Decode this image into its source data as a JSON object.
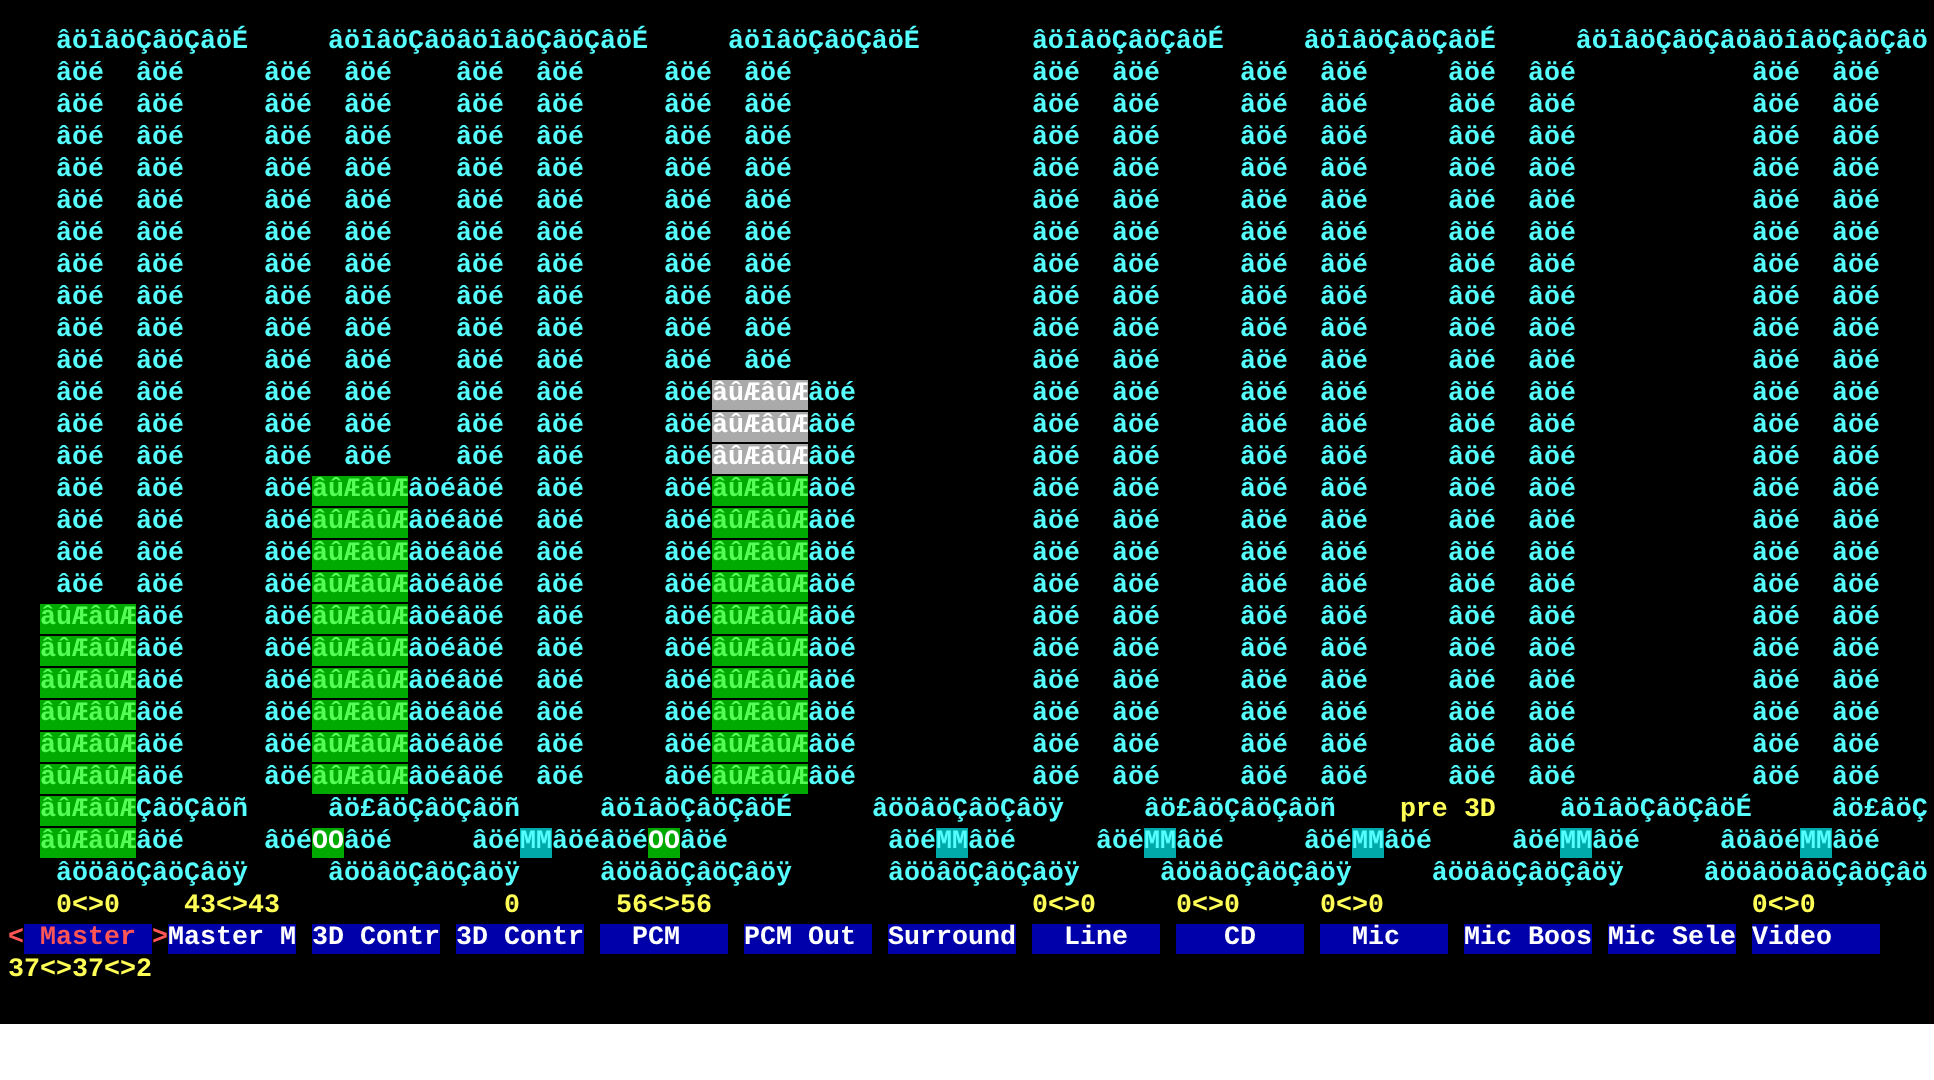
{
  "terminal": {
    "lines": [
      {
        "runs": [
          {
            "kind": "frame",
            "text": "   âöîâöÇâöÇâöÉ     âöîâöÇâöâöîâöÇâöÇâöÉ     âöîâöÇâöÇâöÉ       âöîâöÇâöÇâöÉ     âöîâöÇâöÇâöÉ     âöîâöÇâöÇâöâöîâöÇâöÇâö"
          }
        ]
      },
      {
        "runs": [
          {
            "kind": "frame",
            "text": "   âöé  âöé     âöé  âöé    âöé  âöé     âöé  âöé               âöé  âöé     âöé  âöé     âöé  âöé           âöé  âöé"
          }
        ]
      },
      {
        "runs": [
          {
            "kind": "frame",
            "text": "   âöé  âöé     âöé  âöé    âöé  âöé     âöé  âöé               âöé  âöé     âöé  âöé     âöé  âöé           âöé  âöé"
          }
        ]
      },
      {
        "runs": [
          {
            "kind": "frame",
            "text": "   âöé  âöé     âöé  âöé    âöé  âöé     âöé  âöé               âöé  âöé     âöé  âöé     âöé  âöé           âöé  âöé"
          }
        ]
      },
      {
        "runs": [
          {
            "kind": "frame",
            "text": "   âöé  âöé     âöé  âöé    âöé  âöé     âöé  âöé               âöé  âöé     âöé  âöé     âöé  âöé           âöé  âöé"
          }
        ]
      },
      {
        "runs": [
          {
            "kind": "frame",
            "text": "   âöé  âöé     âöé  âöé    âöé  âöé     âöé  âöé               âöé  âöé     âöé  âöé     âöé  âöé           âöé  âöé"
          }
        ]
      },
      {
        "runs": [
          {
            "kind": "frame",
            "text": "   âöé  âöé     âöé  âöé    âöé  âöé     âöé  âöé               âöé  âöé     âöé  âöé     âöé  âöé           âöé  âöé"
          }
        ]
      },
      {
        "runs": [
          {
            "kind": "frame",
            "text": "   âöé  âöé     âöé  âöé    âöé  âöé     âöé  âöé               âöé  âöé     âöé  âöé     âöé  âöé           âöé  âöé"
          }
        ]
      },
      {
        "runs": [
          {
            "kind": "frame",
            "text": "   âöé  âöé     âöé  âöé    âöé  âöé     âöé  âöé               âöé  âöé     âöé  âöé     âöé  âöé           âöé  âöé"
          }
        ]
      },
      {
        "runs": [
          {
            "kind": "frame",
            "text": "   âöé  âöé     âöé  âöé    âöé  âöé     âöé  âöé               âöé  âöé     âöé  âöé     âöé  âöé           âöé  âöé"
          }
        ]
      },
      {
        "runs": [
          {
            "kind": "frame",
            "text": "   âöé  âöé     âöé  âöé    âöé  âöé     âöé  âöé               âöé  âöé     âöé  âöé     âöé  âöé           âöé  âöé"
          }
        ]
      },
      {
        "runs": [
          {
            "kind": "frame",
            "text": "   âöé  âöé     âöé  âöé    âöé  âöé     âöé"
          },
          {
            "kind": "peak",
            "text": "âûÆâûÆ"
          },
          {
            "kind": "frame",
            "text": "âöé           âöé  âöé     âöé  âöé     âöé  âöé           âöé  âöé"
          }
        ]
      },
      {
        "runs": [
          {
            "kind": "frame",
            "text": "   âöé  âöé     âöé  âöé    âöé  âöé     âöé"
          },
          {
            "kind": "peak",
            "text": "âûÆâûÆ"
          },
          {
            "kind": "frame",
            "text": "âöé           âöé  âöé     âöé  âöé     âöé  âöé           âöé  âöé"
          }
        ]
      },
      {
        "runs": [
          {
            "kind": "frame",
            "text": "   âöé  âöé     âöé  âöé    âöé  âöé     âöé"
          },
          {
            "kind": "peak",
            "text": "âûÆâûÆ"
          },
          {
            "kind": "frame",
            "text": "âöé           âöé  âöé     âöé  âöé     âöé  âöé           âöé  âöé"
          }
        ]
      },
      {
        "runs": [
          {
            "kind": "frame",
            "text": "   âöé  âöé     âöé"
          },
          {
            "kind": "fill",
            "text": "âûÆâûÆ"
          },
          {
            "kind": "frame",
            "text": "âöéâöé  âöé     âöé"
          },
          {
            "kind": "fill",
            "text": "âûÆâûÆ"
          },
          {
            "kind": "frame",
            "text": "âöé           âöé  âöé     âöé  âöé     âöé  âöé           âöé  âöé"
          }
        ]
      },
      {
        "runs": [
          {
            "kind": "frame",
            "text": "   âöé  âöé     âöé"
          },
          {
            "kind": "fill",
            "text": "âûÆâûÆ"
          },
          {
            "kind": "frame",
            "text": "âöéâöé  âöé     âöé"
          },
          {
            "kind": "fill",
            "text": "âûÆâûÆ"
          },
          {
            "kind": "frame",
            "text": "âöé           âöé  âöé     âöé  âöé     âöé  âöé           âöé  âöé"
          }
        ]
      },
      {
        "runs": [
          {
            "kind": "frame",
            "text": "   âöé  âöé     âöé"
          },
          {
            "kind": "fill",
            "text": "âûÆâûÆ"
          },
          {
            "kind": "frame",
            "text": "âöéâöé  âöé     âöé"
          },
          {
            "kind": "fill",
            "text": "âûÆâûÆ"
          },
          {
            "kind": "frame",
            "text": "âöé           âöé  âöé     âöé  âöé     âöé  âöé           âöé  âöé"
          }
        ]
      },
      {
        "runs": [
          {
            "kind": "frame",
            "text": "   âöé  âöé     âöé"
          },
          {
            "kind": "fill",
            "text": "âûÆâûÆ"
          },
          {
            "kind": "frame",
            "text": "âöéâöé  âöé     âöé"
          },
          {
            "kind": "fill",
            "text": "âûÆâûÆ"
          },
          {
            "kind": "frame",
            "text": "âöé           âöé  âöé     âöé  âöé     âöé  âöé           âöé  âöé"
          }
        ]
      },
      {
        "runs": [
          {
            "kind": "fill",
            "text": "  âûÆâûÆ"
          },
          {
            "kind": "frame",
            "text": "âöé     âöé"
          },
          {
            "kind": "fill",
            "text": "âûÆâûÆ"
          },
          {
            "kind": "frame",
            "text": "âöéâöé  âöé     âöé"
          },
          {
            "kind": "fill",
            "text": "âûÆâûÆ"
          },
          {
            "kind": "frame",
            "text": "âöé           âöé  âöé     âöé  âöé     âöé  âöé           âöé  âöé"
          }
        ]
      },
      {
        "runs": [
          {
            "kind": "fill",
            "text": "  âûÆâûÆ"
          },
          {
            "kind": "frame",
            "text": "âöé     âöé"
          },
          {
            "kind": "fill",
            "text": "âûÆâûÆ"
          },
          {
            "kind": "frame",
            "text": "âöéâöé  âöé     âöé"
          },
          {
            "kind": "fill",
            "text": "âûÆâûÆ"
          },
          {
            "kind": "frame",
            "text": "âöé           âöé  âöé     âöé  âöé     âöé  âöé           âöé  âöé"
          }
        ]
      },
      {
        "runs": [
          {
            "kind": "fill",
            "text": "  âûÆâûÆ"
          },
          {
            "kind": "frame",
            "text": "âöé     âöé"
          },
          {
            "kind": "fill",
            "text": "âûÆâûÆ"
          },
          {
            "kind": "frame",
            "text": "âöéâöé  âöé     âöé"
          },
          {
            "kind": "fill",
            "text": "âûÆâûÆ"
          },
          {
            "kind": "frame",
            "text": "âöé           âöé  âöé     âöé  âöé     âöé  âöé           âöé  âöé"
          }
        ]
      },
      {
        "runs": [
          {
            "kind": "fill",
            "text": "  âûÆâûÆ"
          },
          {
            "kind": "frame",
            "text": "âöé     âöé"
          },
          {
            "kind": "fill",
            "text": "âûÆâûÆ"
          },
          {
            "kind": "frame",
            "text": "âöéâöé  âöé     âöé"
          },
          {
            "kind": "fill",
            "text": "âûÆâûÆ"
          },
          {
            "kind": "frame",
            "text": "âöé           âöé  âöé     âöé  âöé     âöé  âöé           âöé  âöé"
          }
        ]
      },
      {
        "runs": [
          {
            "kind": "fill",
            "text": "  âûÆâûÆ"
          },
          {
            "kind": "frame",
            "text": "âöé     âöé"
          },
          {
            "kind": "fill",
            "text": "âûÆâûÆ"
          },
          {
            "kind": "frame",
            "text": "âöéâöé  âöé     âöé"
          },
          {
            "kind": "fill",
            "text": "âûÆâûÆ"
          },
          {
            "kind": "frame",
            "text": "âöé           âöé  âöé     âöé  âöé     âöé  âöé           âöé  âöé"
          }
        ]
      },
      {
        "runs": [
          {
            "kind": "fill",
            "text": "  âûÆâûÆ"
          },
          {
            "kind": "frame",
            "text": "âöé     âöé"
          },
          {
            "kind": "fill",
            "text": "âûÆâûÆ"
          },
          {
            "kind": "frame",
            "text": "âöéâöé  âöé     âöé"
          },
          {
            "kind": "fill",
            "text": "âûÆâûÆ"
          },
          {
            "kind": "frame",
            "text": "âöé           âöé  âöé     âöé  âöé     âöé  âöé           âöé  âöé"
          }
        ]
      },
      {
        "runs": [
          {
            "kind": "fill",
            "text": "  âûÆâûÆ"
          },
          {
            "kind": "frame",
            "text": "ÇâöÇâöñ     âö£âöÇâöÇâöñ     âöîâöÇâöÇâöÉ     âööâöÇâöÇâöÿ     âö£âöÇâöÇâöñ    "
          },
          {
            "kind": "value",
            "text": "pre 3D"
          },
          {
            "kind": "frame",
            "text": "    âöîâöÇâöÇâöÉ     âö£âöÇ"
          }
        ]
      },
      {
        "runs": [
          {
            "kind": "fill",
            "text": "  âûÆâûÆ"
          },
          {
            "kind": "frame",
            "text": "âöé     âöé"
          },
          {
            "kind": "unmute",
            "text": "OO"
          },
          {
            "kind": "frame",
            "text": "âöé     âöé"
          },
          {
            "kind": "mute",
            "text": "MM"
          },
          {
            "kind": "frame",
            "text": "âöéâöé"
          },
          {
            "kind": "unmute",
            "text": "OO"
          },
          {
            "kind": "frame",
            "text": "âöé          âöé"
          },
          {
            "kind": "mute",
            "text": "MM"
          },
          {
            "kind": "frame",
            "text": "âöé     âöé"
          },
          {
            "kind": "mute",
            "text": "MM"
          },
          {
            "kind": "frame",
            "text": "âöé     âöé"
          },
          {
            "kind": "mute",
            "text": "MM"
          },
          {
            "kind": "frame",
            "text": "âöé     âöé"
          },
          {
            "kind": "mute",
            "text": "MM"
          },
          {
            "kind": "frame",
            "text": "âöé     âöâöé"
          },
          {
            "kind": "mute",
            "text": "MM"
          },
          {
            "kind": "frame",
            "text": "âöé"
          }
        ]
      },
      {
        "runs": [
          {
            "kind": "frame",
            "text": "   âööâöÇâöÇâöÿ     âööâöÇâöÇâöÿ     âööâöÇâöÇâöÿ      âööâöÇâöÇâöÿ     âööâöÇâöÇâöÿ     âööâöÇâöÇâöÿ     âööâööâöÇâöÇâö"
          }
        ]
      },
      {
        "runs": [
          {
            "kind": "value",
            "text": "   0<>0    43<>43              0      56<>56                    0<>0     0<>0     0<>0                       0<>0"
          }
        ]
      }
    ]
  },
  "selection_arrows": [
    "<",
    ">"
  ],
  "channel_tabs": [
    {
      "label": " Master ",
      "selected": true
    },
    {
      "label": "Master M",
      "selected": false
    },
    {
      "label": "3D Contr",
      "selected": false
    },
    {
      "label": "3D Contr",
      "selected": false
    },
    {
      "label": "  PCM   ",
      "selected": false
    },
    {
      "label": "PCM Out ",
      "selected": false
    },
    {
      "label": "Surround",
      "selected": false
    },
    {
      "label": "  Line  ",
      "selected": false
    },
    {
      "label": "   CD   ",
      "selected": false
    },
    {
      "label": "  Mic   ",
      "selected": false
    },
    {
      "label": "Mic Boos",
      "selected": false
    },
    {
      "label": "Mic Sele",
      "selected": false
    },
    {
      "label": "Video   ",
      "selected": false
    }
  ],
  "status_line": "37<>37<>2"
}
